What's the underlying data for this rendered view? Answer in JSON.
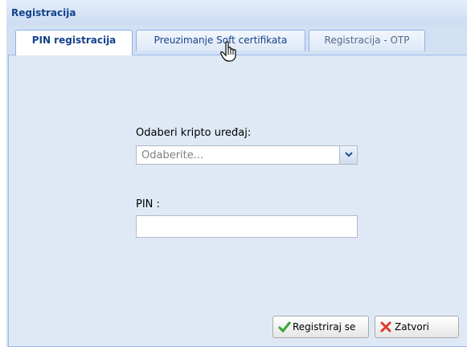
{
  "window": {
    "title": "Registracija"
  },
  "tabs": [
    {
      "label": "PIN registracija",
      "active": true
    },
    {
      "label": "Preuzimanje Soft certifikata",
      "active": false
    },
    {
      "label": "Registracija - OTP",
      "active": false
    }
  ],
  "form": {
    "device_label": "Odaberi kripto uređaj:",
    "device_placeholder": "Odaberite...",
    "pin_label": "PIN :",
    "pin_value": ""
  },
  "buttons": {
    "register_label": "Registriraj se",
    "close_label": "Zatvori"
  },
  "colors": {
    "title": "#15428b",
    "panel": "#dfe9f6",
    "check": "#3aa33a",
    "close_x": "#e03a2a"
  },
  "icons": {
    "register": "check-icon",
    "close": "close-icon",
    "dropdown": "chevron-down-icon",
    "cursor": "hand-pointer-icon"
  }
}
